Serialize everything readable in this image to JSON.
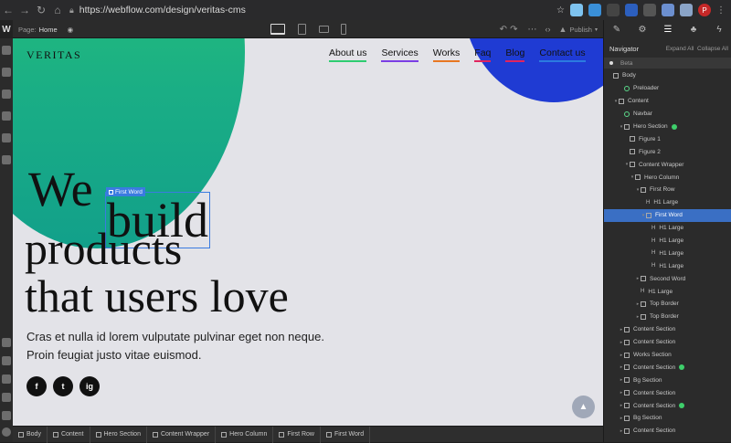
{
  "browser": {
    "url": "https://webflow.com/design/veritas-cms",
    "avatar_letter": "P"
  },
  "top_bar": {
    "logo": "W",
    "page_prefix": "Page:",
    "page_name": "Home",
    "publish_label": "Publish"
  },
  "canvas": {
    "brand": "VERITAS",
    "nav": [
      {
        "label": "About us",
        "color": "#2ecc71"
      },
      {
        "label": "Services",
        "color": "#7b3fe4"
      },
      {
        "label": "Works",
        "color": "#e87722"
      },
      {
        "label": "Faq",
        "color": "#e0245e"
      },
      {
        "label": "Blog",
        "color": "#e0245e"
      },
      {
        "label": "Contact us",
        "color": "#2b7be0"
      }
    ],
    "hero_word1": "We",
    "hero_word2": "build",
    "hero_line2": "products",
    "hero_line3": "that users love",
    "selection_tag": "First Word",
    "subtext": "Cras et nulla id lorem vulputate pulvinar eget non neque. Proin feugiat justo vitae euismod.",
    "socials": [
      "f",
      "t",
      "ig"
    ]
  },
  "breadcrumbs": [
    "Body",
    "Content",
    "Hero Section",
    "Content Wrapper",
    "Hero Column",
    "First Row",
    "First Word"
  ],
  "panel": {
    "title": "Navigator",
    "expand_all": "Expand All",
    "collapse_all": "Collapse All",
    "beta": "Beta",
    "tree": [
      {
        "label": "Body",
        "indent": 0,
        "caret": "",
        "icon": "box"
      },
      {
        "label": "Preloader",
        "indent": 2,
        "caret": "",
        "icon": "green"
      },
      {
        "label": "Content",
        "indent": 1,
        "caret": "▾",
        "icon": "box"
      },
      {
        "label": "Navbar",
        "indent": 2,
        "caret": "",
        "icon": "green"
      },
      {
        "label": "Hero Section",
        "indent": 2,
        "caret": "▾",
        "icon": "box",
        "badge": true
      },
      {
        "label": "Figure 1",
        "indent": 3,
        "caret": "",
        "icon": "box"
      },
      {
        "label": "Figure 2",
        "indent": 3,
        "caret": "",
        "icon": "box"
      },
      {
        "label": "Content Wrapper",
        "indent": 3,
        "caret": "▾",
        "icon": "box"
      },
      {
        "label": "Hero Column",
        "indent": 4,
        "caret": "▾",
        "icon": "box"
      },
      {
        "label": "First Row",
        "indent": 5,
        "caret": "▾",
        "icon": "box"
      },
      {
        "label": "H1 Large",
        "indent": 6,
        "caret": "",
        "icon": "h"
      },
      {
        "label": "First Word",
        "indent": 6,
        "caret": "▾",
        "icon": "box",
        "selected": true
      },
      {
        "label": "H1 Large",
        "indent": 7,
        "caret": "",
        "icon": "h"
      },
      {
        "label": "H1 Large",
        "indent": 7,
        "caret": "",
        "icon": "h"
      },
      {
        "label": "H1 Large",
        "indent": 7,
        "caret": "",
        "icon": "h"
      },
      {
        "label": "H1 Large",
        "indent": 7,
        "caret": "",
        "icon": "h"
      },
      {
        "label": "Second Word",
        "indent": 5,
        "caret": "▸",
        "icon": "box"
      },
      {
        "label": "H1 Large",
        "indent": 5,
        "caret": "",
        "icon": "h"
      },
      {
        "label": "Top Border",
        "indent": 5,
        "caret": "▸",
        "icon": "box"
      },
      {
        "label": "Top Border",
        "indent": 5,
        "caret": "▸",
        "icon": "box"
      },
      {
        "label": "Content Section",
        "indent": 2,
        "caret": "▸",
        "icon": "box"
      },
      {
        "label": "Content Section",
        "indent": 2,
        "caret": "▸",
        "icon": "box"
      },
      {
        "label": "Works Section",
        "indent": 2,
        "caret": "▸",
        "icon": "box"
      },
      {
        "label": "Content Section",
        "indent": 2,
        "caret": "▸",
        "icon": "box",
        "badge": true
      },
      {
        "label": "Bg Section",
        "indent": 2,
        "caret": "▸",
        "icon": "box"
      },
      {
        "label": "Content Section",
        "indent": 2,
        "caret": "▸",
        "icon": "box"
      },
      {
        "label": "Content Section",
        "indent": 2,
        "caret": "▸",
        "icon": "box",
        "badge": true
      },
      {
        "label": "Bg Section",
        "indent": 2,
        "caret": "▸",
        "icon": "box"
      },
      {
        "label": "Content Section",
        "indent": 2,
        "caret": "▸",
        "icon": "box"
      }
    ]
  }
}
